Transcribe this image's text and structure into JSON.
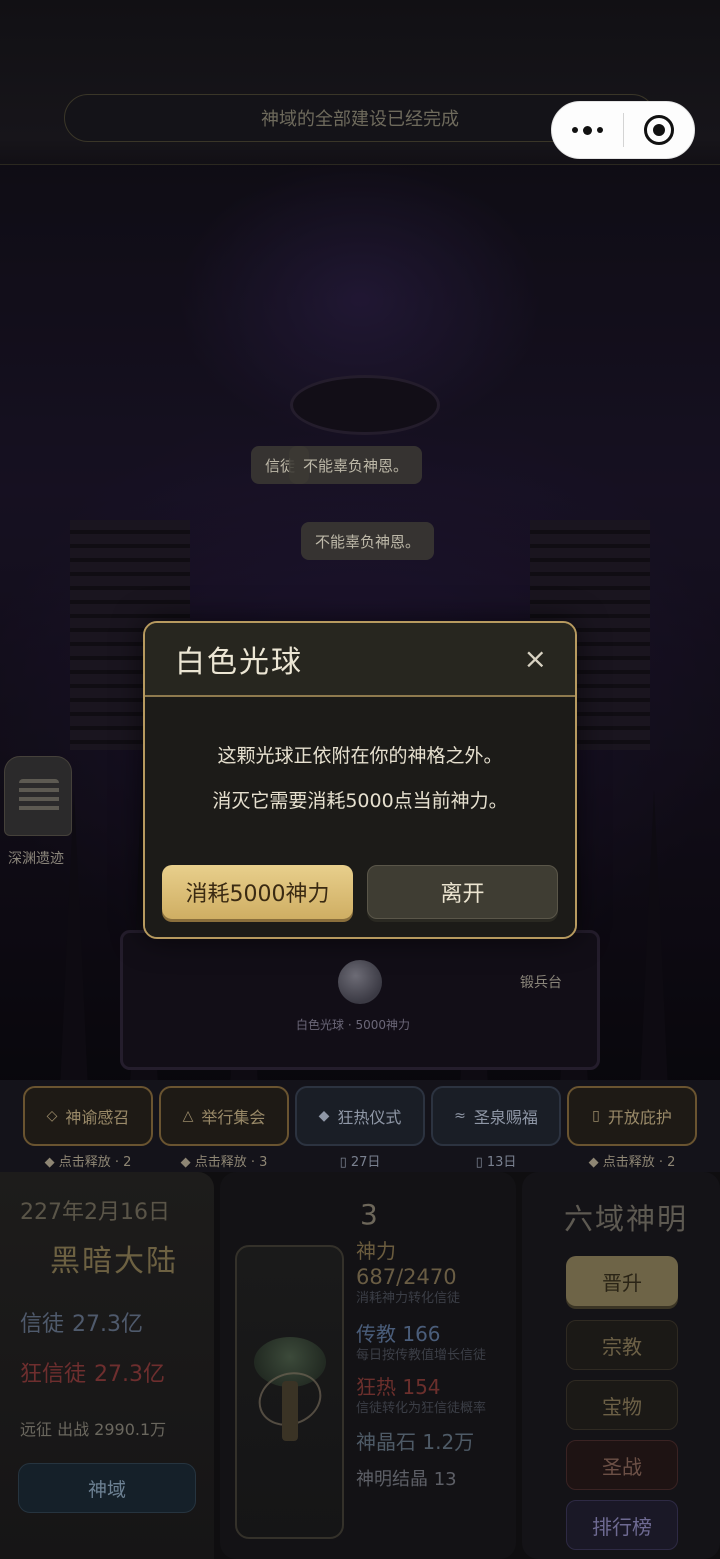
{
  "header": {
    "notice": "神域的全部建设已经完成"
  },
  "scene": {
    "bubbles": [
      "信徒",
      "不能辜负神恩。",
      "不能辜负神恩。"
    ],
    "side_ruin_label": "深渊遗迹",
    "forge_label": "锻兵台",
    "orb_label": "白色光球 · 5000神力"
  },
  "modal": {
    "title": "白色光球",
    "close": "×",
    "line1": "这颗光球正依附在你的神格之外。",
    "line2": "消灭它需要消耗5000点当前神力。",
    "confirm_label": "消耗5000神力",
    "leave_label": "离开"
  },
  "actions": [
    {
      "icon": "◇",
      "label": "神谕感召",
      "sub": "◆ 点击释放 · 2",
      "style": "gold"
    },
    {
      "icon": "△",
      "label": "举行集会",
      "sub": "◆ 点击释放 · 3",
      "style": "gold"
    },
    {
      "icon": "◆",
      "label": "狂热仪式",
      "sub": "▯ 27日",
      "style": "blue"
    },
    {
      "icon": "≈",
      "label": "圣泉赐福",
      "sub": "▯ 13日",
      "style": "blue"
    },
    {
      "icon": "▯",
      "label": "开放庇护",
      "sub": "◆ 点击释放 · 2",
      "style": "gold"
    }
  ],
  "left_panel": {
    "date": "227年2月16日",
    "continent": "黑暗大陆",
    "believers_label": "信徒",
    "believers_value": "27.3亿",
    "zealots_label": "狂信徒",
    "zealots_value": "27.3亿",
    "expedition": "远征 出战 2990.1万",
    "domain_button": "神域"
  },
  "mid_panel": {
    "level": "3",
    "power_label": "神力",
    "power_value": "687/2470",
    "power_desc": "消耗神力转化信徒",
    "preach_label": "传教 166",
    "preach_desc": "每日按传教值增长信徒",
    "frenzy_label": "狂热 154",
    "frenzy_desc": "信徒转化为狂信徒概率",
    "crystal_label": "神晶石 1.2万",
    "essence_label": "神明结晶 13"
  },
  "right_panel": {
    "deity": "六域神明",
    "ascend": "晋升",
    "religion": "宗教",
    "treasure": "宝物",
    "holy_war": "圣战",
    "ranking": "排行榜"
  }
}
